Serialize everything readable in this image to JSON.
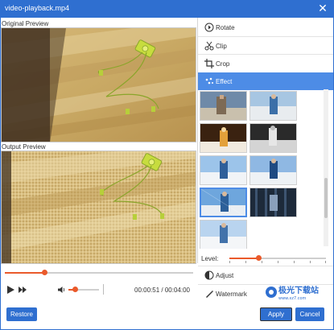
{
  "window": {
    "title": "video-playback.mp4",
    "close_symbol": "✕"
  },
  "preview": {
    "original_label": "Original Preview",
    "output_label": "Output Preview"
  },
  "playback": {
    "progress_fraction": 0.21,
    "volume_fraction": 0.2,
    "current_time": "00:00:51",
    "total_time": "00:04:00",
    "time_separator": "/"
  },
  "menu": {
    "items": [
      {
        "label": "Rotate",
        "icon": "rotate-icon"
      },
      {
        "label": "Clip",
        "icon": "scissors-icon"
      },
      {
        "label": "Crop",
        "icon": "crop-icon"
      },
      {
        "label": "Effect",
        "icon": "effect-icon",
        "active": true
      }
    ],
    "bottom_items": [
      {
        "label": "Adjust",
        "icon": "adjust-icon"
      },
      {
        "label": "Watermark",
        "icon": "watermark-icon"
      }
    ]
  },
  "effects": {
    "selected_index": 6,
    "level_label": "Level:",
    "level_fraction": 0.3
  },
  "buttons": {
    "restore": "Restore",
    "apply": "Apply",
    "cancel": "Cancel"
  },
  "overlay_logo": {
    "text": "极光下载站",
    "subtext": "www.xz7.com"
  },
  "colors": {
    "accent": "#2f6fd0",
    "active_menu": "#4d8ce6",
    "slider": "#ea5a2b"
  }
}
